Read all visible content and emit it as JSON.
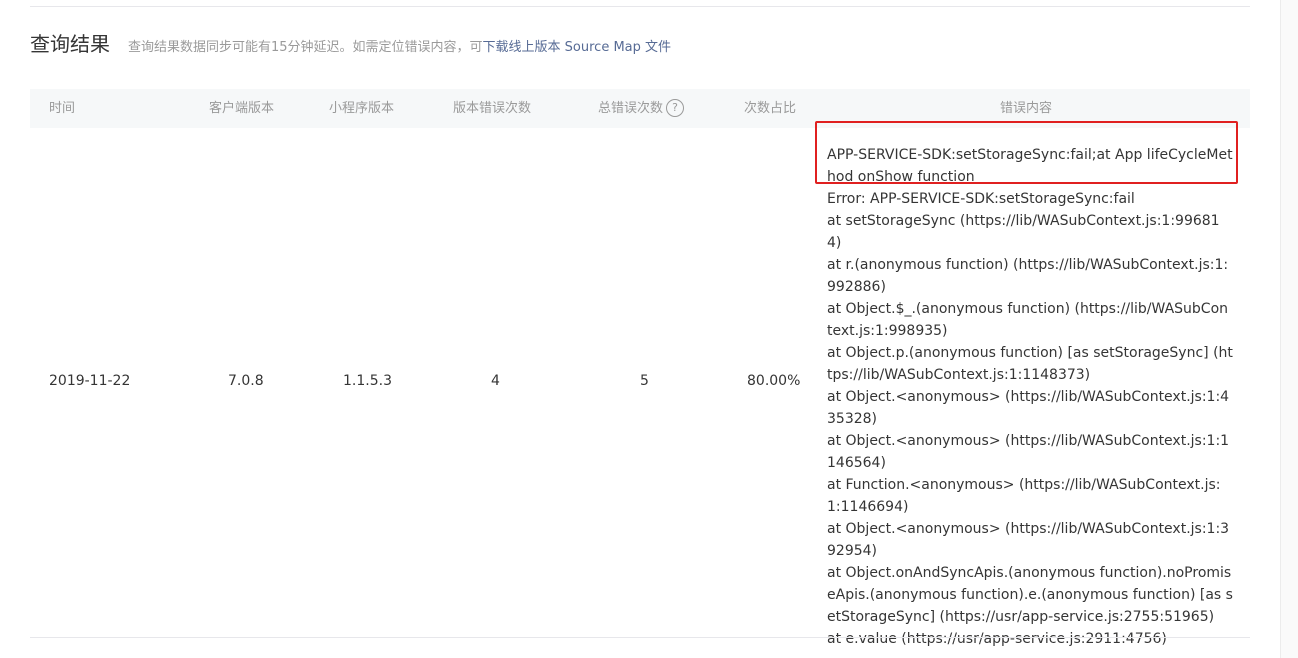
{
  "section": {
    "title": "查询结果",
    "note": "查询结果数据同步可能有15分钟延迟。如需定位错误内容，可",
    "link": "下载线上版本 Source Map 文件"
  },
  "table": {
    "headers": {
      "time": "时间",
      "client_version": "客户端版本",
      "mp_version": "小程序版本",
      "version_errors": "版本错误次数",
      "total_errors": "总错误次数",
      "ratio": "次数占比",
      "error_content": "错误内容"
    },
    "help_icon": "help-circle-icon",
    "row": {
      "time": "2019-11-22",
      "client_version": "7.0.8",
      "mp_version": "1.1.5.3",
      "version_errors": "4",
      "total_errors": "5",
      "ratio": "80.00%",
      "error_lines": [
        "APP-SERVICE-SDK:setStorageSync:fail;at App lifeCycleMethod onShow function",
        "Error: APP-SERVICE-SDK:setStorageSync:fail",
        "at setStorageSync (https://lib/WASubContext.js:1:996814)",
        "at r.(anonymous function) (https://lib/WASubContext.js:1:992886)",
        "at Object.$_.(anonymous function) (https://lib/WASubContext.js:1:998935)",
        "at Object.p.(anonymous function) [as setStorageSync] (https://lib/WASubContext.js:1:1148373)",
        "at Object.<anonymous> (https://lib/WASubContext.js:1:435328)",
        "at Object.<anonymous> (https://lib/WASubContext.js:1:1146564)",
        "at Function.<anonymous> (https://lib/WASubContext.js:1:1146694)",
        "at Object.<anonymous> (https://lib/WASubContext.js:1:392954)",
        "at Object.onAndSyncApis.(anonymous function).noPromiseApis.(anonymous function).e.(anonymous function) [as setStorageSync] (https://usr/app-service.js:2755:51965)",
        "at e.value (https://usr/app-service.js:2911:4756)"
      ]
    }
  },
  "colors": {
    "link": "#576b95",
    "highlight": "#e02020",
    "header_bg": "#f6f8f9"
  }
}
